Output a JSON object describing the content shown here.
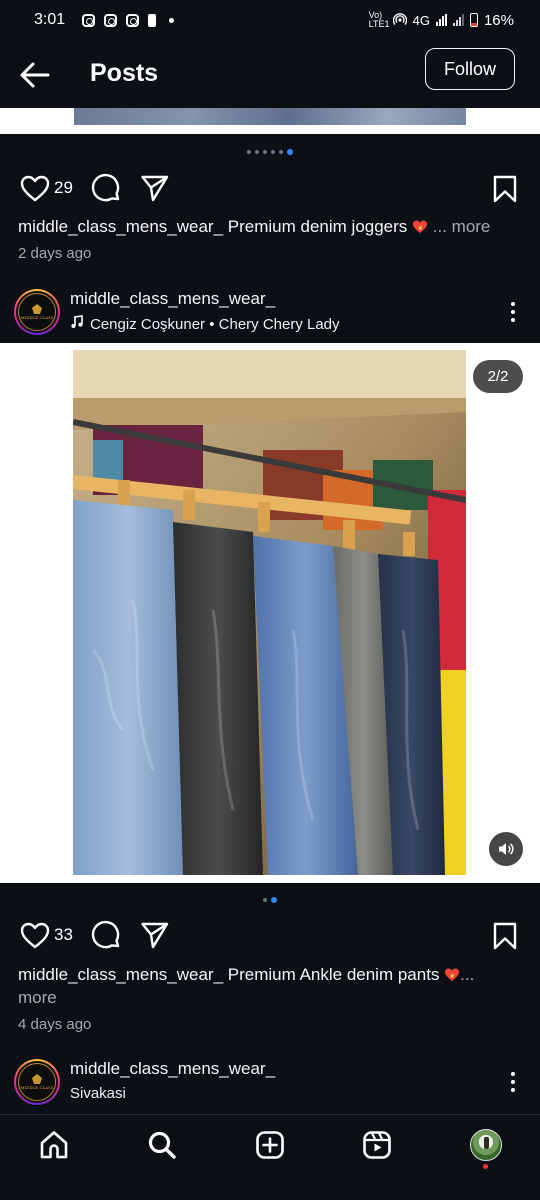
{
  "status_bar": {
    "time": "3:01",
    "network_label": "Vo) LTE1",
    "network_type": "4G",
    "battery": "16%"
  },
  "header": {
    "title": "Posts",
    "follow_label": "Follow"
  },
  "post1": {
    "carousel_dots": 6,
    "carousel_active_index": 5,
    "likes": "29",
    "caption_user": "middle_class_mens_wear_",
    "caption_text": "Premium denim joggers",
    "more_label": "... more",
    "time_ago": "2 days ago"
  },
  "post2": {
    "author": {
      "name": "middle_class_mens_wear_",
      "audio": "Cengiz Coşkuner • Chery Chery Lady"
    },
    "media_counter": "2/2",
    "carousel_dots": 2,
    "carousel_active_index": 1,
    "likes": "33",
    "caption_user": "middle_class_mens_wear_",
    "caption_text": "Premium Ankle denim pants",
    "more_label": "...",
    "more_label_2": "more",
    "time_ago": "4 days ago"
  },
  "post3": {
    "author": {
      "name": "middle_class_mens_wear_",
      "location": "Sivakasi"
    }
  },
  "nav": {
    "items": [
      "home-icon",
      "search-icon",
      "create-icon",
      "reels-icon",
      "profile-avatar"
    ]
  },
  "colors": {
    "background": "#0c1014",
    "text": "#f5f5f5",
    "muted": "#a8a8a8",
    "accent": "#2f8bff",
    "notification": "#ff3040"
  }
}
